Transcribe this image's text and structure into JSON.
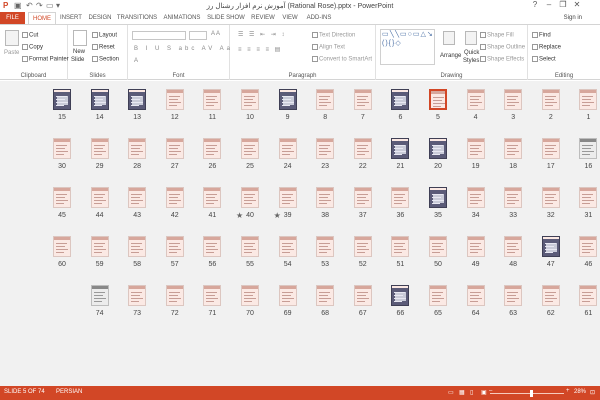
{
  "titlebar": {
    "title": "آموزش نرم افزار رشنال رز (Rational Rose).pptx - PowerPoint",
    "help": "?",
    "min": "–",
    "max": "❐",
    "close": "✕"
  },
  "tabs": [
    "FILE",
    "HOME",
    "INSERT",
    "DESIGN",
    "TRANSITIONS",
    "ANIMATIONS",
    "SLIDE SHOW",
    "REVIEW",
    "VIEW",
    "ADD-INS"
  ],
  "active_tab": "HOME",
  "sign_in": "Sign in",
  "ribbon": {
    "clipboard": {
      "label": "Clipboard",
      "paste": "Paste",
      "cut": "Cut",
      "copy": "Copy",
      "format_painter": "Format Painter"
    },
    "slides": {
      "label": "Slides",
      "new_slide": "New",
      "new_slide2": "Slide",
      "layout": "Layout",
      "reset": "Reset",
      "section": "Section"
    },
    "font": {
      "label": "Font"
    },
    "paragraph": {
      "label": "Paragraph",
      "text_direction": "Text Direction",
      "align_text": "Align Text",
      "convert": "Convert to SmartArt"
    },
    "drawing": {
      "label": "Drawing",
      "shapes_glyphs": "▭╲╲▭○▭△↘↙⇨⇧☆{}(){}◇",
      "arrange": "Arrange",
      "quick_styles": "Quick",
      "quick_styles2": "Styles",
      "shape_fill": "Shape Fill",
      "shape_outline": "Shape Outline",
      "shape_effects": "Shape Effects"
    },
    "editing": {
      "label": "Editing",
      "find": "Find",
      "replace": "Replace",
      "select": "Select"
    }
  },
  "slides": {
    "rows": [
      [
        {
          "n": "15",
          "t": "dark"
        },
        {
          "n": "14",
          "t": "dark"
        },
        {
          "n": "13",
          "t": "dark"
        },
        {
          "n": "12",
          "t": "pink"
        },
        {
          "n": "11",
          "t": "pink"
        },
        {
          "n": "10",
          "t": "pink"
        },
        {
          "n": "9",
          "t": "dark"
        },
        {
          "n": "8",
          "t": "pink"
        },
        {
          "n": "7",
          "t": "pink"
        },
        {
          "n": "6",
          "t": "dark"
        },
        {
          "n": "5",
          "t": "pink",
          "sel": true
        },
        {
          "n": "4",
          "t": "pink"
        },
        {
          "n": "3",
          "t": "pink"
        },
        {
          "n": "2",
          "t": "pink"
        },
        {
          "n": "1",
          "t": "pink"
        }
      ],
      [
        {
          "n": "30",
          "t": "pink"
        },
        {
          "n": "29",
          "t": "pink"
        },
        {
          "n": "28",
          "t": "pink"
        },
        {
          "n": "27",
          "t": "pink"
        },
        {
          "n": "26",
          "t": "pink"
        },
        {
          "n": "25",
          "t": "pink"
        },
        {
          "n": "24",
          "t": "pink"
        },
        {
          "n": "23",
          "t": "pink"
        },
        {
          "n": "22",
          "t": "pink"
        },
        {
          "n": "21",
          "t": "dark"
        },
        {
          "n": "20",
          "t": "dark"
        },
        {
          "n": "19",
          "t": "pink"
        },
        {
          "n": "18",
          "t": "pink"
        },
        {
          "n": "17",
          "t": "pink"
        },
        {
          "n": "16",
          "t": "gray"
        }
      ],
      [
        {
          "n": "45",
          "t": "pink"
        },
        {
          "n": "44",
          "t": "pink"
        },
        {
          "n": "43",
          "t": "pink"
        },
        {
          "n": "42",
          "t": "pink"
        },
        {
          "n": "41",
          "t": "pink"
        },
        {
          "n": "40",
          "t": "pink",
          "star": true
        },
        {
          "n": "39",
          "t": "pink",
          "star": true
        },
        {
          "n": "38",
          "t": "pink"
        },
        {
          "n": "37",
          "t": "pink"
        },
        {
          "n": "36",
          "t": "pink"
        },
        {
          "n": "35",
          "t": "dark"
        },
        {
          "n": "34",
          "t": "pink"
        },
        {
          "n": "33",
          "t": "pink"
        },
        {
          "n": "32",
          "t": "pink"
        },
        {
          "n": "31",
          "t": "pink"
        }
      ],
      [
        {
          "n": "60",
          "t": "pink"
        },
        {
          "n": "59",
          "t": "pink"
        },
        {
          "n": "58",
          "t": "pink"
        },
        {
          "n": "57",
          "t": "pink"
        },
        {
          "n": "56",
          "t": "pink"
        },
        {
          "n": "55",
          "t": "pink"
        },
        {
          "n": "54",
          "t": "pink"
        },
        {
          "n": "53",
          "t": "pink"
        },
        {
          "n": "52",
          "t": "pink"
        },
        {
          "n": "51",
          "t": "pink"
        },
        {
          "n": "50",
          "t": "pink"
        },
        {
          "n": "49",
          "t": "pink"
        },
        {
          "n": "48",
          "t": "pink"
        },
        {
          "n": "47",
          "t": "dark"
        },
        {
          "n": "46",
          "t": "pink"
        }
      ],
      [
        {
          "n": "",
          "t": "none"
        },
        {
          "n": "74",
          "t": "gray"
        },
        {
          "n": "73",
          "t": "pink"
        },
        {
          "n": "72",
          "t": "pink"
        },
        {
          "n": "71",
          "t": "pink"
        },
        {
          "n": "70",
          "t": "pink"
        },
        {
          "n": "69",
          "t": "pink"
        },
        {
          "n": "68",
          "t": "pink"
        },
        {
          "n": "67",
          "t": "pink"
        },
        {
          "n": "66",
          "t": "dark"
        },
        {
          "n": "65",
          "t": "pink"
        },
        {
          "n": "64",
          "t": "pink"
        },
        {
          "n": "63",
          "t": "pink"
        },
        {
          "n": "62",
          "t": "pink"
        },
        {
          "n": "61",
          "t": "pink"
        }
      ]
    ]
  },
  "status": {
    "slide_info": "SLIDE 5 OF 74",
    "language": "PERSIAN",
    "zoom": "28%",
    "zoom_minus": "–",
    "zoom_plus": "+",
    "zoom_fraction": 0.55
  },
  "colors": {
    "accent": "#d24726",
    "selection": "#d24726"
  }
}
